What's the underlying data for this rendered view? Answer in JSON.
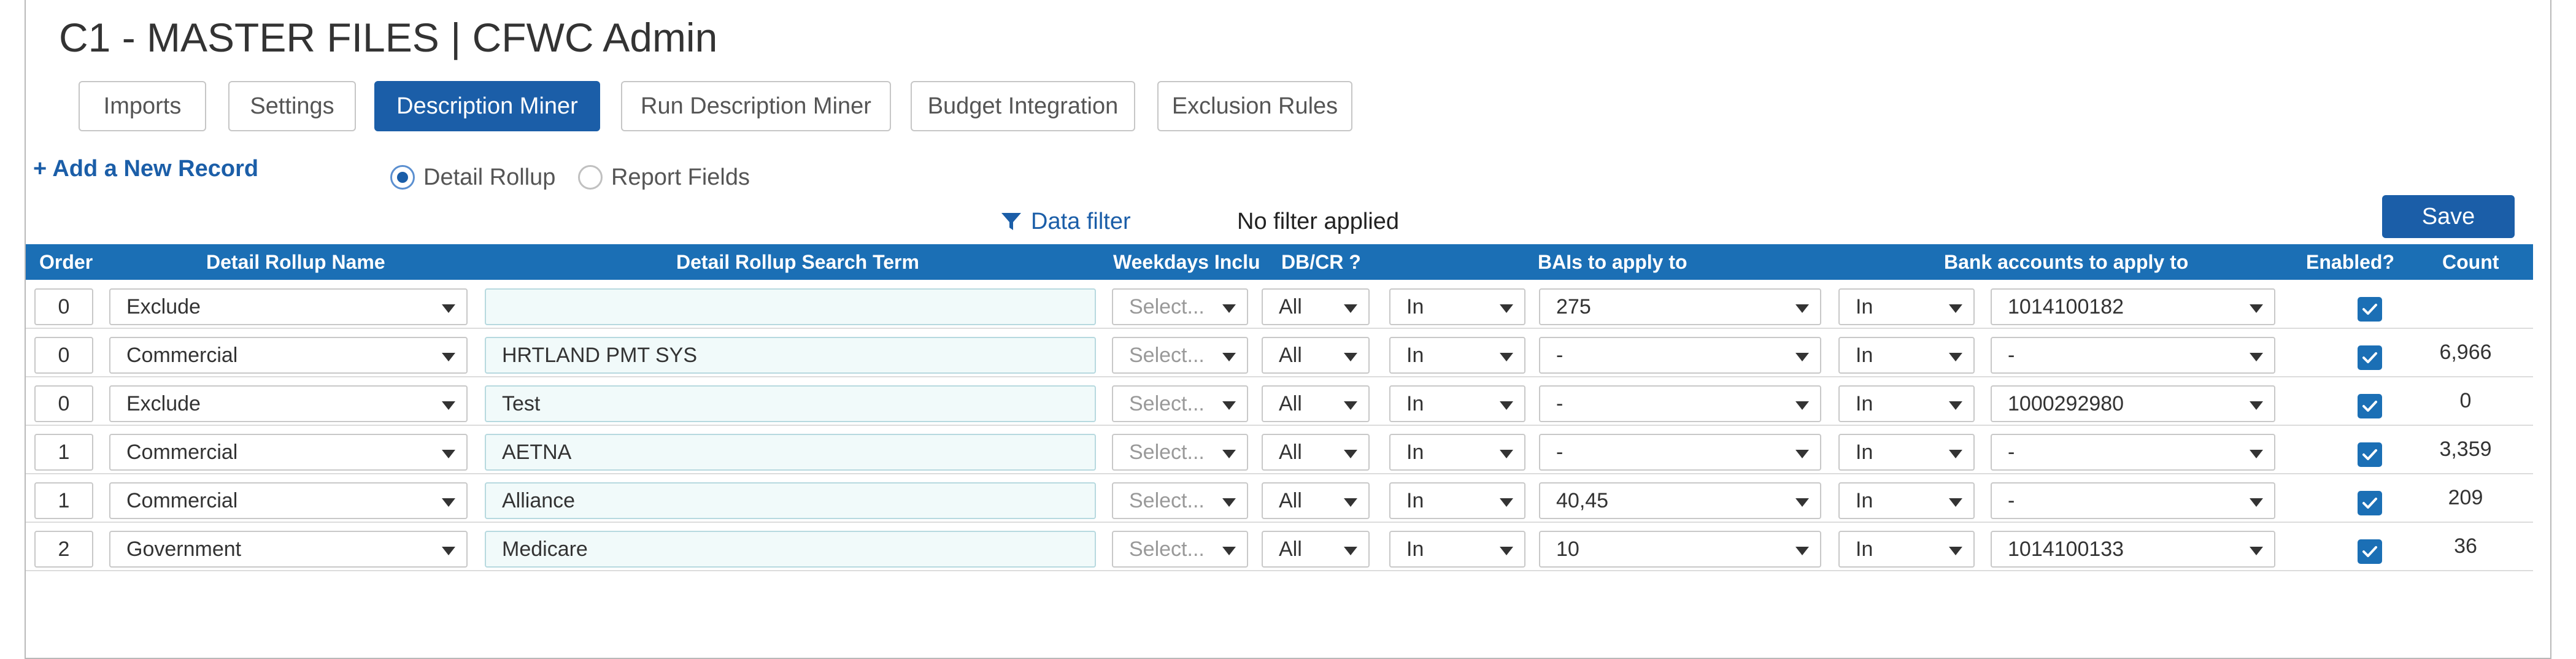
{
  "page": {
    "title": "C1 - MASTER FILES | CFWC Admin"
  },
  "tabs": [
    {
      "label": "Imports",
      "active": false
    },
    {
      "label": "Settings",
      "active": false
    },
    {
      "label": "Description Miner",
      "active": true
    },
    {
      "label": "Run Description Miner",
      "active": false
    },
    {
      "label": "Budget Integration",
      "active": false
    },
    {
      "label": "Exclusion Rules",
      "active": false
    }
  ],
  "toolbar": {
    "add_record": "+ Add a New Record",
    "radio_options": [
      {
        "label": "Detail Rollup",
        "checked": true
      },
      {
        "label": "Report Fields",
        "checked": false
      }
    ],
    "filter_link": "Data filter",
    "filter_status": "No filter applied",
    "save_label": "Save"
  },
  "grid": {
    "columns": [
      "Order",
      "Detail Rollup Name",
      "Detail Rollup Search Term",
      "Weekdays Includ",
      "DB/CR ?",
      "BAIs to apply to",
      "Bank accounts to apply to",
      "Enabled?",
      "Count"
    ],
    "weekdays_placeholder": "Select...",
    "rows": [
      {
        "order": "0",
        "rollup": "Exclude",
        "term": "",
        "dbcr": "All",
        "bai_op": "In",
        "bais": "275",
        "acct_op": "In",
        "accounts": "1014100182",
        "enabled": true,
        "count": ""
      },
      {
        "order": "0",
        "rollup": "Commercial",
        "term": "HRTLAND PMT SYS",
        "dbcr": "All",
        "bai_op": "In",
        "bais": "-",
        "acct_op": "In",
        "accounts": "-",
        "enabled": true,
        "count": "6,966"
      },
      {
        "order": "0",
        "rollup": "Exclude",
        "term": "Test",
        "dbcr": "All",
        "bai_op": "In",
        "bais": "-",
        "acct_op": "In",
        "accounts": "1000292980",
        "enabled": true,
        "count": "0"
      },
      {
        "order": "1",
        "rollup": "Commercial",
        "term": "AETNA",
        "dbcr": "All",
        "bai_op": "In",
        "bais": "-",
        "acct_op": "In",
        "accounts": "-",
        "enabled": true,
        "count": "3,359"
      },
      {
        "order": "1",
        "rollup": "Commercial",
        "term": "Alliance",
        "dbcr": "All",
        "bai_op": "In",
        "bais": "40,45",
        "acct_op": "In",
        "accounts": "-",
        "enabled": true,
        "count": "209"
      },
      {
        "order": "2",
        "rollup": "Government",
        "term": "Medicare",
        "dbcr": "All",
        "bai_op": "In",
        "bais": "10",
        "acct_op": "In",
        "accounts": "1014100133",
        "enabled": true,
        "count": "36"
      }
    ]
  },
  "colors": {
    "primary": "#1b5ea8",
    "header": "#1b6fb5",
    "teal_input": "#f1fafa"
  },
  "icons": {
    "filter": "funnel-icon",
    "dropdown": "caret-down-icon",
    "check": "check-icon"
  }
}
